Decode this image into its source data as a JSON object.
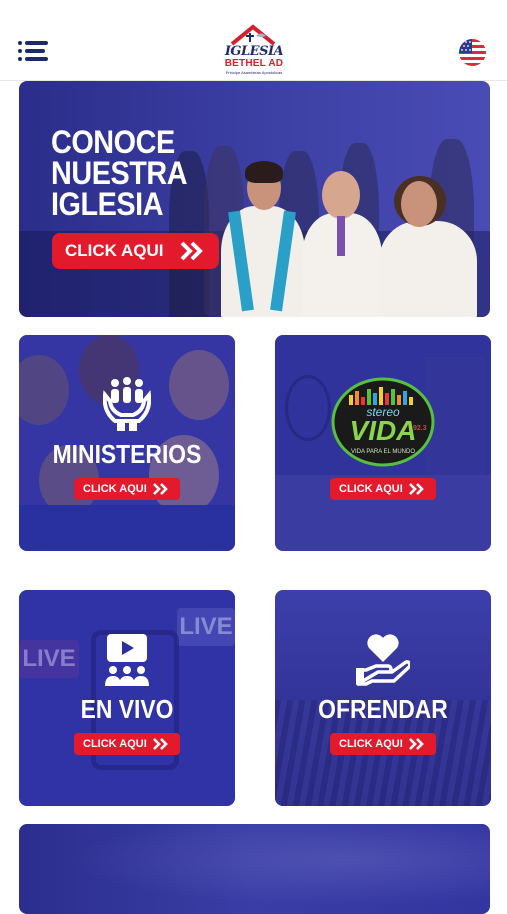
{
  "header": {
    "logo_line1": "IGLESIA",
    "logo_line2": "BETHEL AD",
    "logo_line3": "Principe Asambleas Apostolicas"
  },
  "hero": {
    "title_line1": "CONOCE",
    "title_line2": "NUESTRA",
    "title_line3": "IGLESIA",
    "button_label": "CLICK AQUI"
  },
  "tiles": [
    {
      "label": "MINISTERIOS",
      "button_label": "CLICK AQUI",
      "icon": "people-hands-icon"
    },
    {
      "label": "",
      "button_label": "CLICK AQUI",
      "icon": "stereo-vida-logo",
      "logo_text": "VIDA",
      "logo_top": "stereo",
      "logo_sub": "VIDA PARA EL MUNDO",
      "logo_freq": "92.3"
    },
    {
      "label": "EN VIVO",
      "button_label": "CLICK AQUI",
      "icon": "live-video-icon",
      "bg_words": [
        "LIVE",
        "LIVE"
      ]
    },
    {
      "label": "OFRENDAR",
      "button_label": "CLICK AQUI",
      "icon": "heart-hand-icon"
    }
  ],
  "colors": {
    "brand_blue": "#1f2a6e",
    "overlay_blue": "#2426a0",
    "button_red": "#e21a2c"
  }
}
